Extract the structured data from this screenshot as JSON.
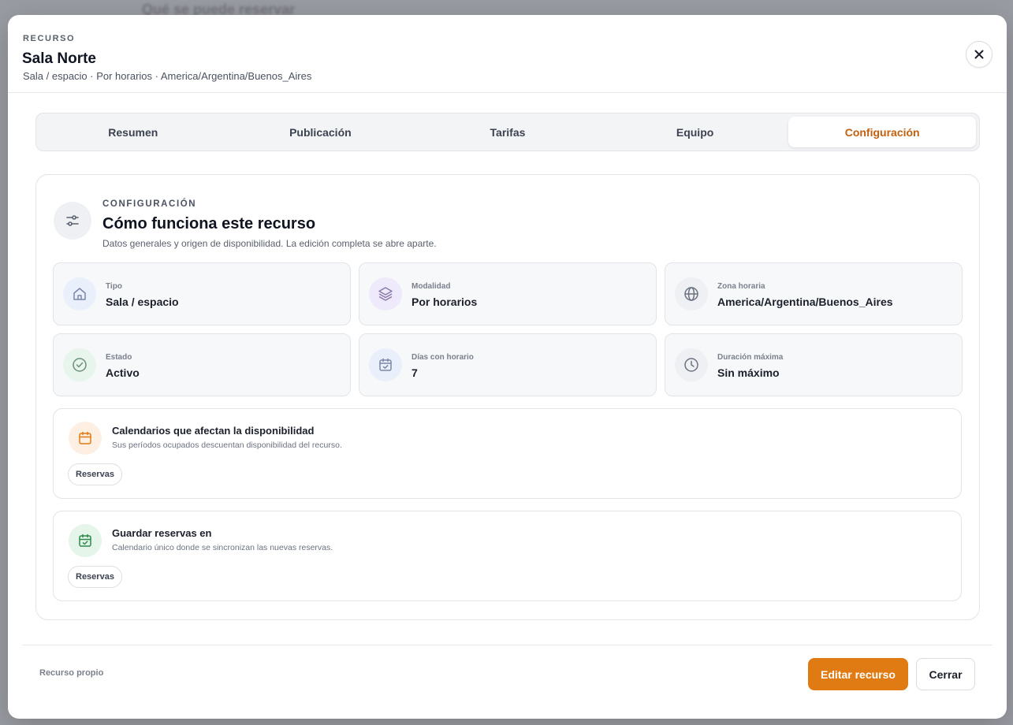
{
  "backdrop": {
    "text": "Qué se puede reservar"
  },
  "header": {
    "eyebrow": "RECURSO",
    "title": "Sala Norte",
    "subtitle": "Sala / espacio · Por horarios · America/Argentina/Buenos_Aires",
    "close_icon": "close-icon"
  },
  "tabs": [
    {
      "label": "Resumen",
      "active": false
    },
    {
      "label": "Publicación",
      "active": false
    },
    {
      "label": "Tarifas",
      "active": false
    },
    {
      "label": "Equipo",
      "active": false
    },
    {
      "label": "Configuración",
      "active": true
    }
  ],
  "panel": {
    "eyebrow": "CONFIGURACIÓN",
    "title": "Cómo funciona este recurso",
    "description": "Datos generales y origen de disponibilidad. La edición completa se abre aparte.",
    "icon": "sliders-icon"
  },
  "cards": [
    {
      "label": "Tipo",
      "value": "Sala / espacio",
      "icon": "home-icon",
      "icon_color": "#7a87a8",
      "icon_bg": "#eaf0fb"
    },
    {
      "label": "Modalidad",
      "value": "Por horarios",
      "icon": "layers-icon",
      "icon_color": "#8a7aa8",
      "icon_bg": "#efeafb"
    },
    {
      "label": "Zona horaria",
      "value": "America/Argentina/Buenos_Aires",
      "icon": "globe-icon",
      "icon_color": "#6b7280",
      "icon_bg": "#eef0f4"
    },
    {
      "label": "Estado",
      "value": "Activo",
      "icon": "check-circle-icon",
      "icon_color": "#6b8f7a",
      "icon_bg": "#e8f5ec"
    },
    {
      "label": "Días con horario",
      "value": "7",
      "icon": "calendar-check-icon",
      "icon_color": "#7a87a8",
      "icon_bg": "#eaf0fb"
    },
    {
      "label": "Duración máxima",
      "value": "Sin máximo",
      "icon": "clock-icon",
      "icon_color": "#6b7280",
      "icon_bg": "#eef0f4"
    }
  ],
  "sections": [
    {
      "title": "Calendarios que afectan la disponibilidad",
      "description": "Sus períodos ocupados descuentan disponibilidad del recurso.",
      "chip": "Reservas",
      "icon": "calendar-icon",
      "icon_color": "#e07a12",
      "icon_bg": "#fdf0e2"
    },
    {
      "title": "Guardar reservas en",
      "description": "Calendario único donde se sincronizan las nuevas reservas.",
      "chip": "Reservas",
      "icon": "calendar-check-icon",
      "icon_color": "#2f8a4e",
      "icon_bg": "#e5f5ea"
    }
  ],
  "footer": {
    "note": "Recurso propio",
    "primary_label": "Editar recurso",
    "secondary_label": "Cerrar"
  }
}
